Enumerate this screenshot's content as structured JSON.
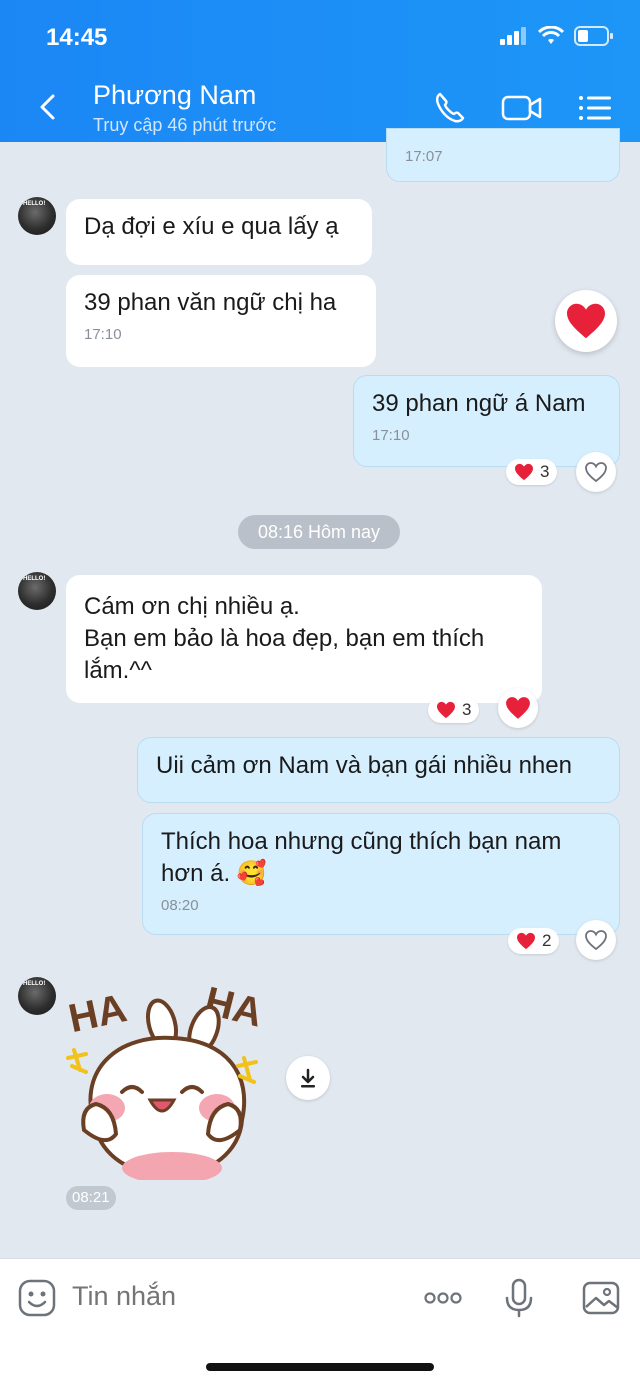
{
  "status_bar": {
    "time": "14:45"
  },
  "header": {
    "contact_name": "Phương Nam",
    "last_seen": "Truy cập 46 phút trước",
    "icons": [
      "back-arrow-icon",
      "phone-icon",
      "video-call-icon",
      "menu-list-icon"
    ]
  },
  "messages": {
    "prev_time": "17:07",
    "m1": {
      "text": "Dạ đợi e xíu e qua lấy ạ"
    },
    "m2": {
      "text": "39 phan văn ngữ chị ha",
      "time": "17:10"
    },
    "m3": {
      "text": "39 phan ngữ á Nam",
      "time": "17:10",
      "reaction_count": "3"
    },
    "date_divider": "08:16 Hôm nay",
    "m4": {
      "line1": "Cám ơn chị nhiều ạ.",
      "line2": "Bạn em bảo là hoa đẹp, bạn em thích lắm.^^",
      "reaction_count": "3"
    },
    "m5": {
      "text": "Uii cảm ơn Nam và bạn gái nhiều nhen"
    },
    "m6": {
      "text": "Thích hoa nhưng cũng thích bạn nam hơn á. 🥰",
      "time": "08:20",
      "reaction_count": "2"
    },
    "sticker": {
      "text_left": "HA",
      "text_right": "HA",
      "time": "08:21"
    }
  },
  "avatar_label": "HELLO!",
  "footer": {
    "placeholder": "Tin nhắn"
  },
  "colors": {
    "header": "#1b87f5",
    "incoming": "#ffffff",
    "outgoing": "#d5efff",
    "background": "#e2e8f0",
    "heart": "#e8213b"
  }
}
